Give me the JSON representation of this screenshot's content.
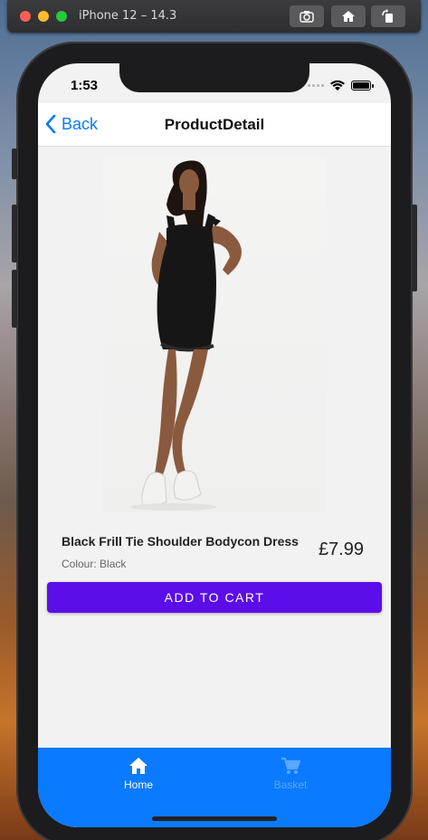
{
  "simulator": {
    "title": "iPhone 12 – 14.3",
    "buttons": [
      "screenshot-icon",
      "home-icon",
      "rotate-icon"
    ]
  },
  "status_bar": {
    "time": "1:53",
    "icons": [
      "signal-icon",
      "wifi-icon",
      "battery-icon"
    ]
  },
  "nav": {
    "back_label": "Back",
    "title": "ProductDetail"
  },
  "product": {
    "image_icon": "product-photo",
    "name": "Black Frill Tie Shoulder Bodycon Dress",
    "colour": "Colour: Black",
    "price": "£7.99",
    "add_to_cart_label": "ADD TO CART"
  },
  "tabbar": {
    "tabs": [
      {
        "label": "Home",
        "icon": "home-icon",
        "active": true
      },
      {
        "label": "Basket",
        "icon": "cart-icon",
        "active": false
      }
    ]
  },
  "colors": {
    "accent": "#0a7aff",
    "button": "#5b0eea",
    "tab_inactive": "#5aa8ff"
  }
}
